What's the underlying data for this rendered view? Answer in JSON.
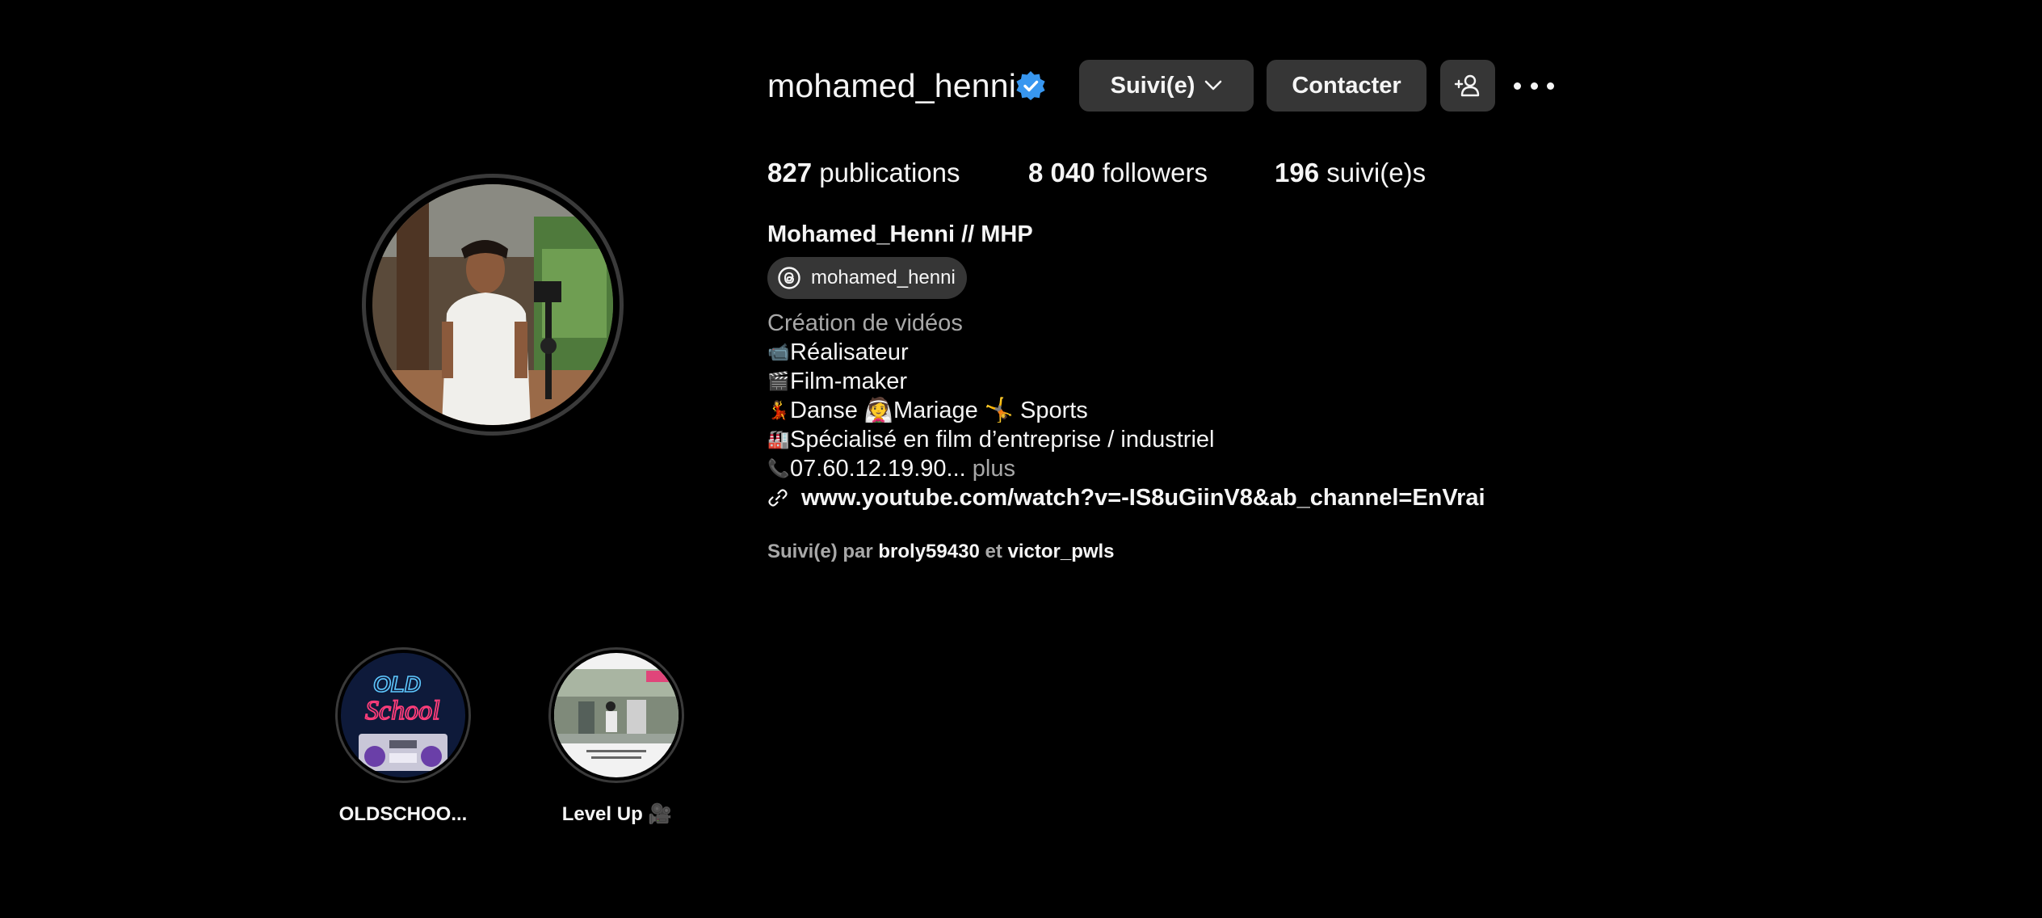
{
  "profile": {
    "username": "mohamed_henni",
    "follow_button": "Suivi(e)",
    "contact_button": "Contacter",
    "stats": {
      "posts_count": "827",
      "posts_label": "publications",
      "followers_count": "8 040",
      "followers_label": "followers",
      "following_count": "196",
      "following_label": "suivi(e)s"
    },
    "full_name": "Mohamed_Henni // MHP",
    "threads_handle": "mohamed_henni",
    "category": "Création de vidéos",
    "bio_lines": [
      {
        "emoji": "📹",
        "text": "Réalisateur"
      },
      {
        "emoji": "🎬",
        "text": "Film-maker"
      },
      {
        "emoji": "💃",
        "text": "Danse 👰Mariage 🤸 Sports"
      },
      {
        "emoji": "🏭",
        "text": "Spécialisé en film d’entreprise / industriel"
      },
      {
        "emoji": "📞",
        "text": "07.60.12.19.90..."
      }
    ],
    "more_label": " plus",
    "link": "www.youtube.com/watch?v=-IS8uGiinV8&ab_channel=EnVrai",
    "followed_by": {
      "prefix": "Suivi(e) par ",
      "user1": "broly59430",
      "joiner": " et ",
      "user2": "victor_pwls"
    }
  },
  "highlights": [
    {
      "label": "OLDSCHOO...",
      "image_text": [
        "OLD",
        "School"
      ]
    },
    {
      "label": "Level Up 🎥"
    }
  ],
  "icons": {
    "verified": "verified-badge-icon",
    "chevron": "chevron-down-icon",
    "add_user": "add-user-icon",
    "more": "more-options-icon",
    "threads": "threads-icon",
    "link": "link-icon"
  },
  "colors": {
    "background": "#000000",
    "button": "#363636",
    "verified": "#3897f0",
    "secondary_text": "#a8a8a8"
  }
}
